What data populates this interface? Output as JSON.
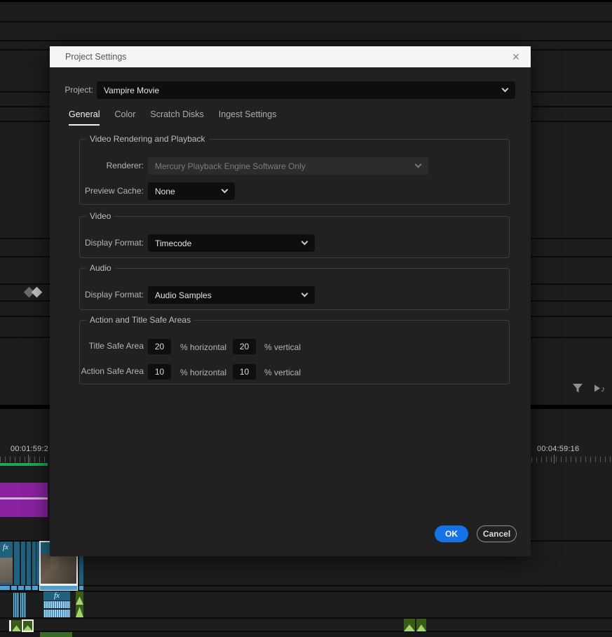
{
  "dialog": {
    "title": "Project Settings",
    "project": {
      "label": "Project:",
      "value": "Vampire Movie"
    },
    "tabs": [
      {
        "label": "General",
        "active": true
      },
      {
        "label": "Color",
        "active": false
      },
      {
        "label": "Scratch Disks",
        "active": false
      },
      {
        "label": "Ingest Settings",
        "active": false
      }
    ],
    "rendering": {
      "legend": "Video Rendering and Playback",
      "renderer_label": "Renderer:",
      "renderer_value": "Mercury Playback Engine Software Only",
      "preview_cache_label": "Preview Cache:",
      "preview_cache_value": "None"
    },
    "video": {
      "legend": "Video",
      "label": "Display Format:",
      "value": "Timecode"
    },
    "audio": {
      "legend": "Audio",
      "label": "Display Format:",
      "value": "Audio Samples"
    },
    "safe_areas": {
      "legend": "Action and Title Safe Areas",
      "horizontal_suffix": "% horizontal",
      "vertical_suffix": "% vertical",
      "rows": [
        {
          "label": "Title Safe Area",
          "horizontal": "20",
          "vertical": "20"
        },
        {
          "label": "Action Safe Area",
          "horizontal": "10",
          "vertical": "10"
        }
      ]
    },
    "buttons": {
      "ok": "OK",
      "cancel": "Cancel"
    }
  },
  "timeline": {
    "ruler": {
      "left_timecode": "00:01:59:2",
      "right_timecode": "00:04:59:16"
    },
    "fx_badge": "fx"
  },
  "icons": {
    "close": "✕",
    "chevron_down": "chevron-css-shape",
    "filter": "funnel-svg-shape",
    "play_audio": "play-triangle-with-note-svg",
    "transition": "double-diamond-shape"
  },
  "colors": {
    "accent_blue": "#1473e6",
    "title_bar": "#f5f5f5",
    "dialog_bg": "#212121",
    "clip_teal": "#1f6280",
    "clip_purple": "#8a22a0",
    "render_bar_green": "#1fa851",
    "clip_green": "#3a5c18",
    "waveform_light_blue": "#9fd0ec"
  }
}
